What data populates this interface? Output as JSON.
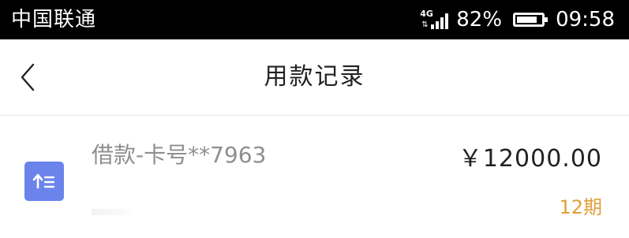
{
  "status_bar": {
    "carrier": "中国联通",
    "network": "4G",
    "battery_percent": "82%",
    "battery_level": 0.82,
    "time": "09:58"
  },
  "nav": {
    "back_icon": "chevron-left-icon",
    "title": "用款记录"
  },
  "records": [
    {
      "icon": "upload-list-icon",
      "title": "借款-卡号**7963",
      "amount": "￥12000.00",
      "term": "12期"
    }
  ],
  "colors": {
    "status_bar_bg": "#000000",
    "icon_bg": "#6b84ec",
    "term_color": "#e0a03a",
    "title_color": "#8e8e8e"
  }
}
